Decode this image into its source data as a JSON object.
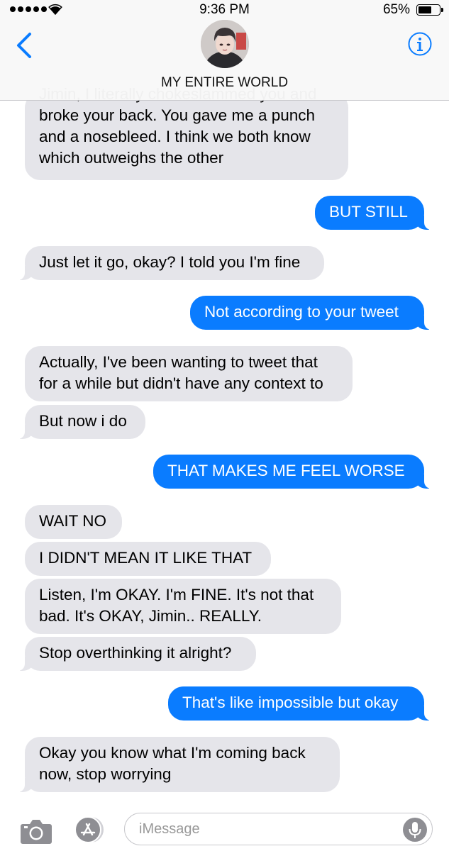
{
  "status_bar": {
    "time": "9:36 PM",
    "battery_percent": "65%",
    "battery_level": 0.65,
    "signal_bars": 5
  },
  "header": {
    "contact_name": "MY ENTIRE WORLD",
    "accent_color": "#0a7cff"
  },
  "messages": [
    {
      "from": "them",
      "text_lines": [
        "Jimin, I literally chokeslammed you and",
        "broke your back. You gave me a punch",
        "and a nosebleed. I think we both know",
        "which outweighs the other"
      ]
    },
    {
      "from": "me",
      "text_lines": [
        "BUT STILL"
      ]
    },
    {
      "from": "them",
      "text_lines": [
        "Just let it go, okay? I told you I'm fine"
      ]
    },
    {
      "from": "me",
      "text_lines": [
        "Not according to your tweet"
      ]
    },
    {
      "from": "them",
      "text_lines": [
        "Actually, I've been wanting to tweet that",
        "for a while but didn't have any context to"
      ]
    },
    {
      "from": "them",
      "text_lines": [
        "But now i do"
      ]
    },
    {
      "from": "me",
      "text_lines": [
        "THAT MAKES ME FEEL WORSE"
      ]
    },
    {
      "from": "them",
      "text_lines": [
        "WAIT NO"
      ]
    },
    {
      "from": "them",
      "text_lines": [
        "I DIDN'T MEAN IT LIKE THAT"
      ]
    },
    {
      "from": "them",
      "text_lines": [
        "Listen, I'm OKAY. I'm FINE. It's not that",
        "bad. It's OKAY, Jimin.. REALLY."
      ]
    },
    {
      "from": "them",
      "text_lines": [
        "Stop overthinking it alright?"
      ]
    },
    {
      "from": "me",
      "text_lines": [
        "That's like impossible but okay"
      ]
    },
    {
      "from": "them",
      "text_lines": [
        "Okay you know what I'm coming back",
        "now, stop worrying"
      ]
    }
  ],
  "input_bar": {
    "placeholder": "iMessage"
  },
  "colors": {
    "incoming_bubble": "#e5e5ea",
    "outgoing_bubble": "#0a7cff"
  },
  "icons": {
    "back": "chevron-left-icon",
    "info": "info-icon",
    "camera": "camera-icon",
    "apps": "app-store-icon",
    "mic": "microphone-icon"
  }
}
